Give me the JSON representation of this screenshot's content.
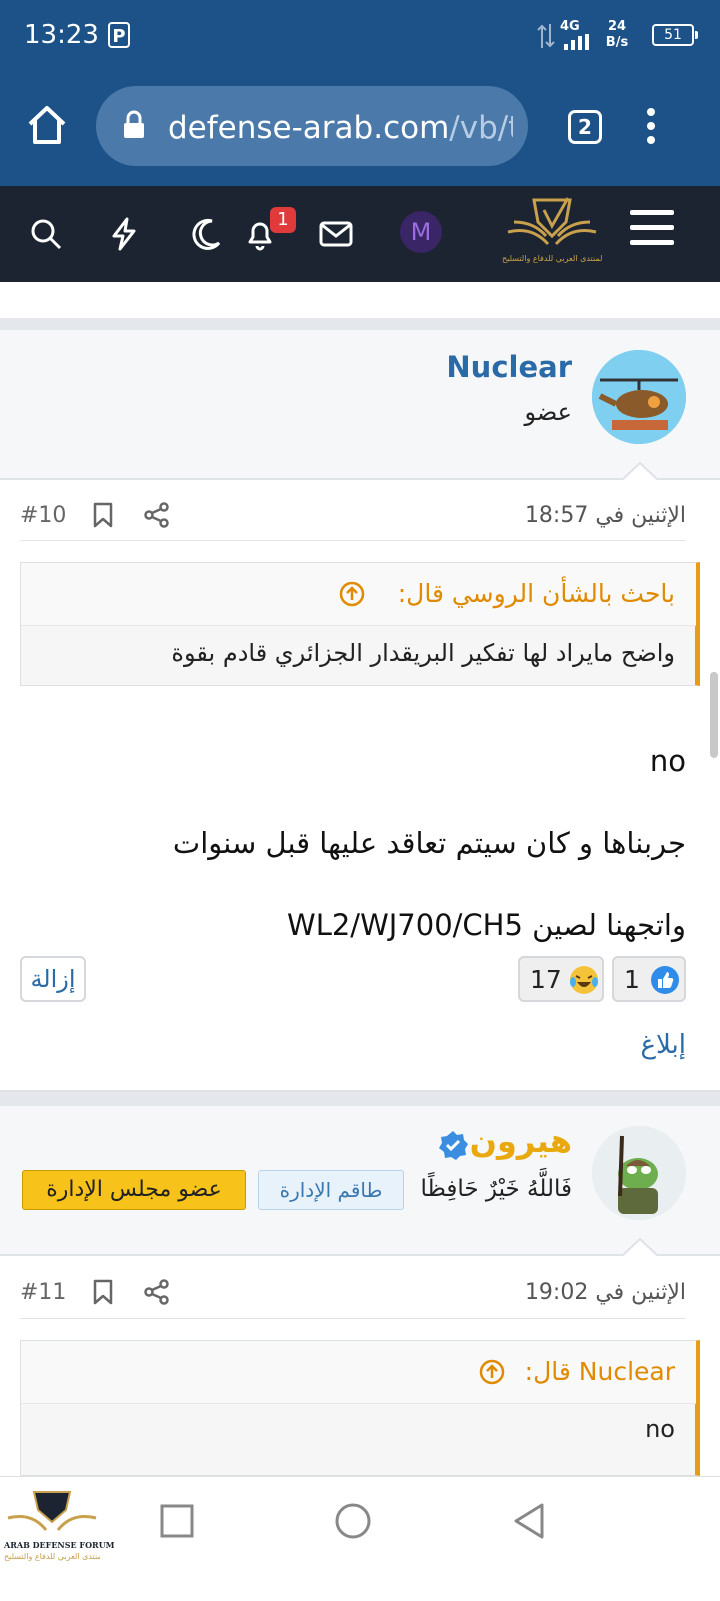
{
  "status_bar": {
    "time": "13:23",
    "p_icon": "P",
    "network_4g": "4G",
    "speed_value": "24",
    "speed_unit": "B/s",
    "battery": "51"
  },
  "browser": {
    "url_domain": "defense-arab.com",
    "url_path": "/vb/th",
    "tab_count": "2"
  },
  "forum_nav": {
    "notification_count": "1",
    "avatar_letter": "M",
    "logo_caption": "المنتدى العربي للدفاع والتسليح"
  },
  "posts": [
    {
      "username": "Nuclear",
      "role": "عضو",
      "date": "الإثنين في 18:57",
      "number": "#10",
      "quote_author": "باحث بالشأن الروسي قال:",
      "quote_text": "واضح مايراد لها تفكير البريقدار الجزائري قادم بقوة",
      "lines": [
        "no",
        "جربناها و كان سيتم تعاقد عليها قبل سنوات",
        "واتجهنا لصين WL2/WJ700/CH5"
      ],
      "like_count": "1",
      "haha_count": "17",
      "remove_label": "إزالة",
      "report_label": "إبلاغ"
    },
    {
      "username": "هيرون",
      "user_title": "فَاللَّهُ خَيْرٌ حَافِظًا",
      "badge_staff": "طاقم الإدارة",
      "badge_board": "عضو مجلس الإدارة",
      "date": "الإثنين في 19:02",
      "number": "#11",
      "quote_author": "Nuclear قال:",
      "quote_text": "no"
    }
  ],
  "footer_logo": {
    "line1": "ARAB DEFENSE FORUM",
    "line2": "المنتدى العربي للدفاع والتسليح"
  },
  "colors": {
    "chrome_blue": "#1d5289",
    "forum_bar": "#1b2430",
    "link_blue": "#2a6aa7",
    "quote_orange": "#e08a00",
    "heron_gold": "#e9a80c",
    "badge_yellow": "#f7c31a"
  }
}
